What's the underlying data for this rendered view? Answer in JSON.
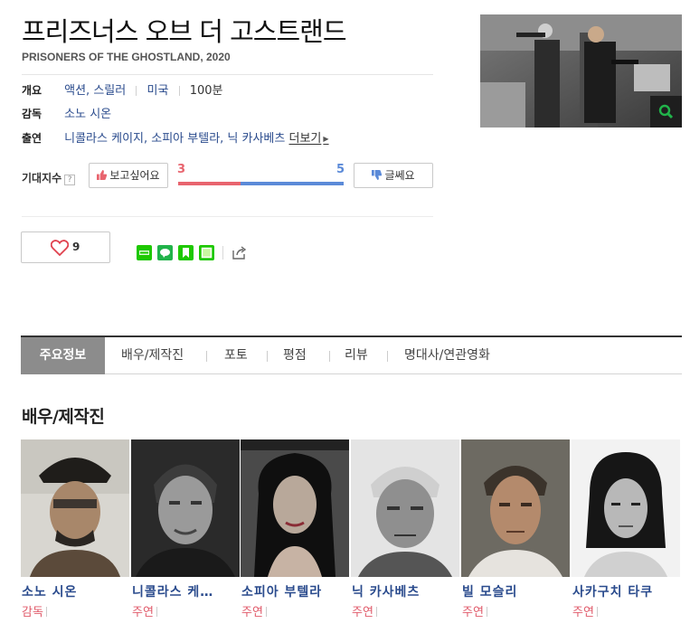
{
  "movie": {
    "title": "프리즈너스 오브 더 고스트랜드",
    "subtitle": "PRISONERS OF THE GHOSTLAND, 2020"
  },
  "info": {
    "overview_label": "개요",
    "genre": "액션, 스릴러",
    "country": "미국",
    "runtime": "100분",
    "director_label": "감독",
    "director": "소노 시온",
    "cast_label": "출연",
    "cast": "니콜라스 케이지, 소피아 부텔라, 닉 카사베츠",
    "more_label": "더보기"
  },
  "expectation": {
    "label": "기대지수",
    "help": "?",
    "want_label": "보고싶어요",
    "want_count": "3",
    "no_label": "글쎄요",
    "no_count": "5",
    "want_fraction": 0.375,
    "want_color": "#e8646e",
    "no_color": "#5b8ad8"
  },
  "like": {
    "count": "9"
  },
  "share": {
    "icons": [
      "band-icon",
      "line-icon",
      "bookmark-icon",
      "memo-icon",
      "share-out-icon"
    ]
  },
  "tabs": [
    "주요정보",
    "배우/제작진",
    "포토",
    "평점",
    "리뷰",
    "명대사/연관영화"
  ],
  "section": {
    "cast_title": "배우/제작진"
  },
  "cast_cards": [
    {
      "name": "소노 시온",
      "role": "감독"
    },
    {
      "name": "니콜라스 케…",
      "role": "주연"
    },
    {
      "name": "소피아 부텔라",
      "role": "주연"
    },
    {
      "name": "닉 카사베츠",
      "role": "주연"
    },
    {
      "name": "빌 모슬리",
      "role": "주연"
    },
    {
      "name": "사카구치 타쿠",
      "role": "주연"
    }
  ],
  "colors": {
    "link": "#2a4b8d",
    "role": "#e05a6a",
    "active_tab": "#8c8c8c"
  }
}
